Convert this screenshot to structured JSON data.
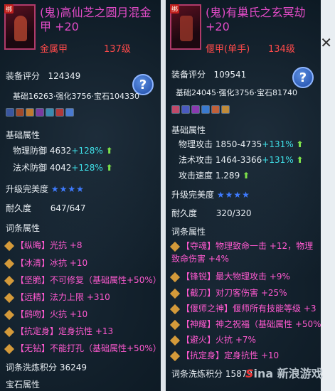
{
  "left_item": {
    "badge": "绑",
    "name": "(鬼)高仙芝之圆月混金甲 +20",
    "type": "金属甲",
    "level": "137级",
    "score_label": "装备评分",
    "score": "124349",
    "breakdown": "基础16263·强化3756·宝石104330",
    "base_label": "基础属性",
    "base_stats": [
      {
        "label": "物理防御",
        "value": "4632",
        "bonus": "+128%"
      },
      {
        "label": "法术防御",
        "value": "4042",
        "bonus": "+128%"
      }
    ],
    "upgrade_label": "升级完美度",
    "upgrade_stars": "★★★★",
    "durability_label": "耐久度",
    "durability": "647/647",
    "affix_label": "词条属性",
    "affixes": [
      "【纵晦】光抗 +8",
      "【冰清】冰抗 +10",
      "【坚脆】不可修复（基础属性+50%）",
      "【远精】法力上限 +310",
      "【鸱吻】火抗 +10",
      "【抗定身】定身抗性 +13",
      "【无钻】不能打孔（基础属性+50%）"
    ],
    "refine_label": "词条洗炼积分",
    "refine_score": "36249",
    "gem_label": "宝石属性"
  },
  "right_item": {
    "badge": "绑",
    "name": "(鬼)有巢氏之玄冥劫 +20",
    "type": "偃甲(单手)",
    "level": "134级",
    "score_label": "装备评分",
    "score": "109541",
    "breakdown": "基础24045·强化3756·宝石81740",
    "base_label": "基础属性",
    "base_stats": [
      {
        "label": "物理攻击",
        "value": "1850-4735",
        "bonus": "+131%"
      },
      {
        "label": "法术攻击",
        "value": "1464-3366",
        "bonus": "+131%"
      }
    ],
    "speed_label": "攻击速度",
    "speed": "1.289",
    "upgrade_label": "升级完美度",
    "upgrade_stars": "★★★★",
    "durability_label": "耐久度",
    "durability": "320/320",
    "affix_label": "词条属性",
    "affixes": [
      "【夺魂】物理致命一击 +12，物理致命伤害 +4%",
      "【锋锐】最大物理攻击 +9%",
      "【截刀】对刀客伤害 +25%",
      "【偃师之神】偃师所有技能等级 +3",
      "【神耀】神之祝福（基础属性 +50%）",
      "【避火】火抗 +7%",
      "【抗定身】定身抗性 +10"
    ],
    "refine_label": "词条洗炼积分",
    "refine_score": "15879"
  },
  "help_icon": "?",
  "close_icon": "✕",
  "watermark": {
    "brand_letter": "S",
    "brand": "ina",
    "site": "新浪游戏"
  },
  "colors": {
    "name": "#e24bc7",
    "level": "#ff4a4a",
    "bonus": "#3fe0e8",
    "affix": "#ff59d0",
    "star": "#3e7bff"
  }
}
